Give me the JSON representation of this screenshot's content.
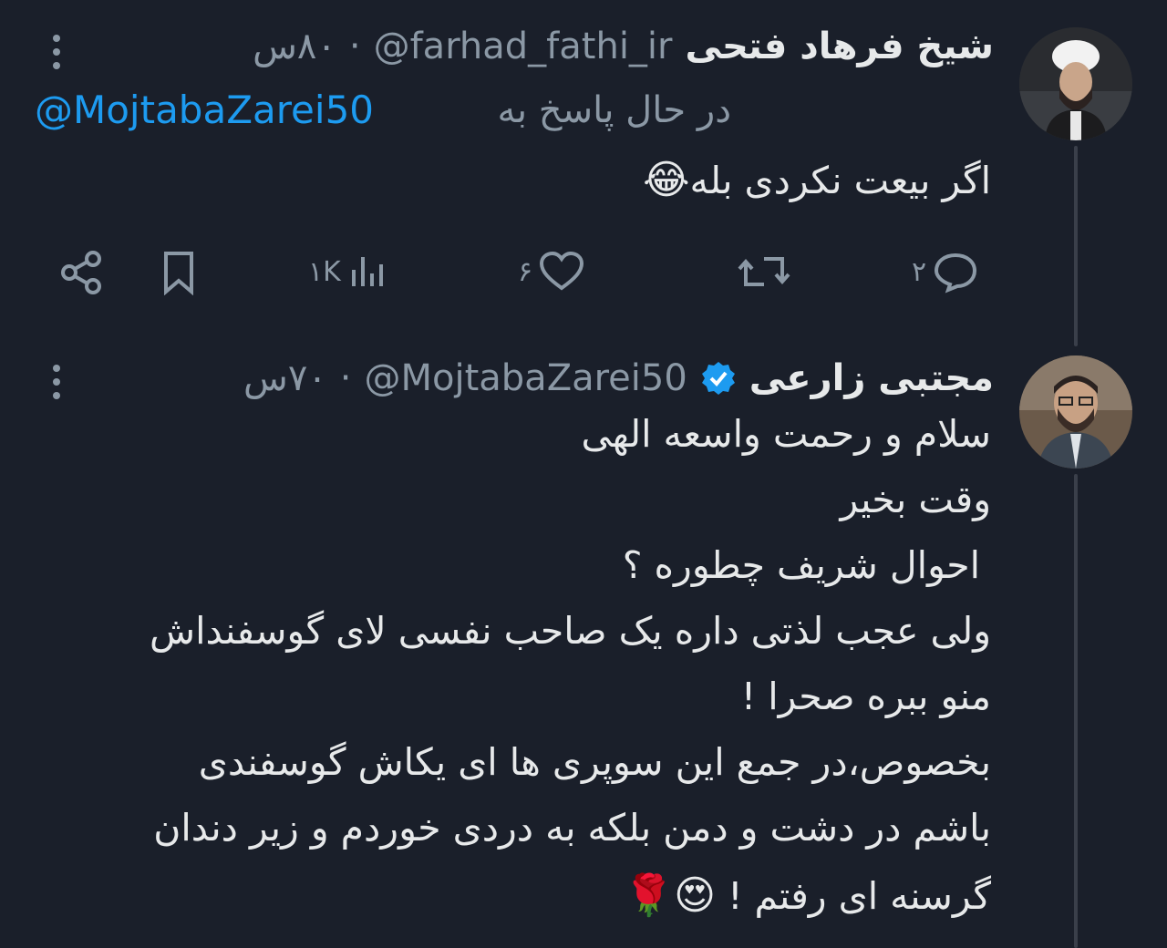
{
  "tweet1": {
    "display_name": "شیخ فرهاد فتحی",
    "handle": "@farhad_fathi_ir",
    "time": "۸۰س",
    "reply_prefix": "در حال پاسخ به",
    "reply_handle": "@MojtabaZarei50",
    "text": "اگر بیعت نکردی بله",
    "emoji": "😂",
    "actions": {
      "replies": "۲",
      "retweets": "",
      "likes": "۶",
      "views": "۱K"
    }
  },
  "tweet2": {
    "display_name": "مجتبی زارعی",
    "handle": "@MojtabaZarei50",
    "time": "۷۰س",
    "lines": [
      "سلام و رحمت واسعه الهی",
      "وقت بخیر",
      "احوال شریف چطوره ؟",
      "ولی عجب لذتی داره یک صاحب نفسی لای گوسفنداش",
      "منو ببره صحرا !",
      "بخصوص،در جمع این سوپری ها ای یکاش گوسفندی",
      "باشم در دشت و دمن بلکه به دردی خوردم و زیر دندان",
      "گرسنه ای رفتم !"
    ],
    "last_line_emojis": "😍🌹"
  },
  "colors": {
    "background": "#1a1f2a",
    "text": "#e7e9ea",
    "secondary": "#8b98a5",
    "accent": "#1d9bf0"
  }
}
